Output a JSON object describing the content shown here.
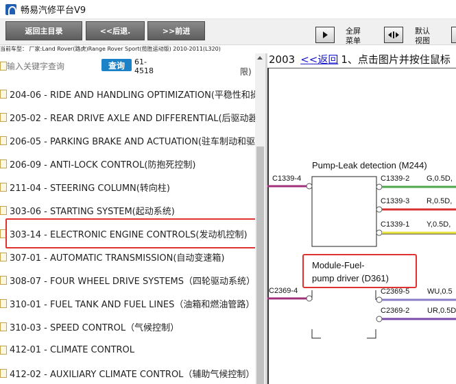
{
  "app": {
    "title": "畅易汽修平台V9"
  },
  "toolbar": {
    "back_home": "返回主目录",
    "back": "<<后退.",
    "forward": ">>前进",
    "fullscreen": [
      "全屏",
      "菜单"
    ],
    "default_view": [
      "默认",
      "视图"
    ]
  },
  "model_line": "当前车型：  厂家:Land Rover(路虎)Range Rover Sport(揽胜运动版) 2010-2011(L320)",
  "search": {
    "placeholder": "输入关键字查询",
    "button": "查询",
    "code_frag": [
      "61-",
      "4518"
    ],
    "bracket_frag": "限)"
  },
  "left_list": [
    "204-06 - RIDE AND HANDLING OPTIMIZATION(平稳性和操",
    "205-02 - REAR DRIVE AXLE AND DIFFERENTIAL(后驱动器和",
    "206-05 - PARKING BRAKE AND ACTUATION(驻车制动和驱",
    "206-09 - ANTI-LOCK CONTROL(防抱死控制)",
    "211-04 - STEERING COLUMN(转向柱)",
    "303-06 - STARTING SYSTEM(起动系统)",
    "303-14 - ELECTRONIC ENGINE CONTROLS(发动机控制)",
    "307-01 - AUTOMATIC TRANSMISSION(自动变速箱)",
    "308-07 - FOUR WHEEL DRIVE SYSTEMS（四轮驱动系统）",
    "310-01 - FUEL TANK AND FUEL LINES（油箱和燃油管路）",
    "310-03 - SPEED CONTROL（气候控制）",
    "412-01 - CLIMATE CONTROL",
    "412-02 - AUXILIARY CLIMATE CONTROL（辅助气候控制）"
  ],
  "right": {
    "year": "2003",
    "back_link": "<<返回",
    "instruction": "1、点击图片并按住鼠标"
  },
  "diagram": {
    "m244_title": "Pump-Leak detection (M244)",
    "d361_title_1": "Module-Fuel-",
    "d361_title_2": "pump driver (D361)",
    "c1339_4": "C1339-4",
    "c1339_2": "C1339-2",
    "c1339_3": "C1339-3",
    "c1339_1": "C1339-1",
    "w_g": "G,0.5D,",
    "w_r": "R,0.5D,",
    "w_y": "Y,0.5D,",
    "c2369_4": "C2369-4",
    "c2369_5": "C2369-5",
    "c2369_2": "C2369-2",
    "w_wu": "WU,0.5",
    "w_ur": "UR,0.5D"
  },
  "colors": {
    "highlight": "#e0312f",
    "link": "#1a1ac8",
    "search_button": "#1b82c8"
  }
}
